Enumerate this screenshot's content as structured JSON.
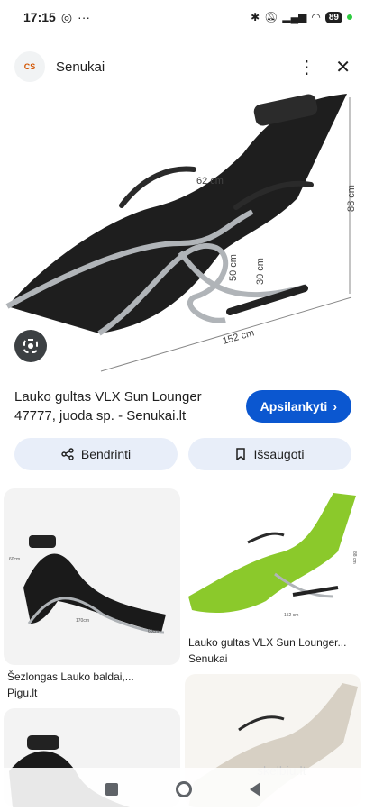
{
  "status": {
    "time": "17:15",
    "battery": "89"
  },
  "header": {
    "logo_text": "CS",
    "site_name": "Senukai",
    "more_icon": "more-vert-icon",
    "close_icon": "close-icon"
  },
  "hero": {
    "dim_width": "152 cm",
    "dim_height": "88 cm",
    "dim_depth": "62 cm",
    "dim_seat": "50 cm",
    "dim_base": "30 cm",
    "lens_icon": "lens-icon"
  },
  "result": {
    "title": "Lauko gultas VLX Sun Lounger 47777, juoda sp. - Senukai.lt",
    "visit_label": "Apsilankyti"
  },
  "actions": {
    "share_label": "Bendrinti",
    "save_label": "Išsaugoti"
  },
  "related": [
    {
      "caption": "Šezlongas Lauko baldai,...",
      "source": "Pigu.lt",
      "color": "#1a1a1a"
    },
    {
      "caption": "Lauko gultas VLX Sun Lounger...",
      "source": "Senukai",
      "color": "#8bc92b"
    },
    {
      "caption": "",
      "source": "",
      "color": "#1a1a1a"
    },
    {
      "caption": "",
      "source": "",
      "color": "#d7d0c4"
    }
  ],
  "related_labels": {
    "card1_dim_w": "170cm",
    "card1_dim_d": "60cm",
    "card1_dim_h": "60cm",
    "card2_dim_w": "152 cm",
    "card2_dim_h": "88 cm",
    "watermark": "skelbiu.lt"
  }
}
